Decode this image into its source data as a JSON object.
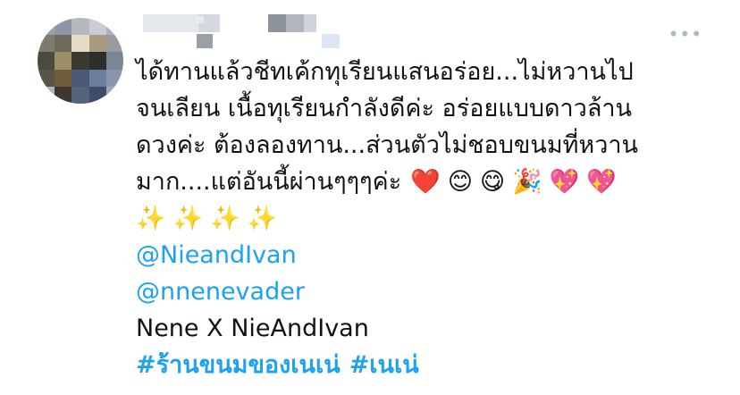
{
  "tweet": {
    "more_icon": "ellipsis-icon",
    "more_glyph": "•••",
    "lines": [
      "ได้ทานแล้วชีทเค้กทุเรียนแสนอร่อย...ไม่หวานไป",
      "จนเลียน เนื้อทุเรียนกำลังดีค่ะ อร่อยแบบดาวล้าน",
      "ดวงค่ะ ต้องลองทาน...ส่วนตัวไม่ชอบขนมที่หวาน",
      "มาก....แต่อันนี้ผ่านๆๆๆค่ะ"
    ],
    "line4_emojis": [
      "❤️",
      "😊",
      "😋",
      "🎉",
      "💖",
      "💖"
    ],
    "sparkles": [
      "✨",
      "✨",
      "✨",
      "✨"
    ],
    "mentions": [
      "@NieandIvan",
      "@nnenevader"
    ],
    "collab_text": "Nene X NieAndIvan",
    "hashtags": [
      "#ร้านขนมของเนเน่",
      "#เนเน่"
    ]
  },
  "colors": {
    "link": "#1da1f2",
    "text": "#0f1419",
    "muted": "#aab8c2"
  }
}
